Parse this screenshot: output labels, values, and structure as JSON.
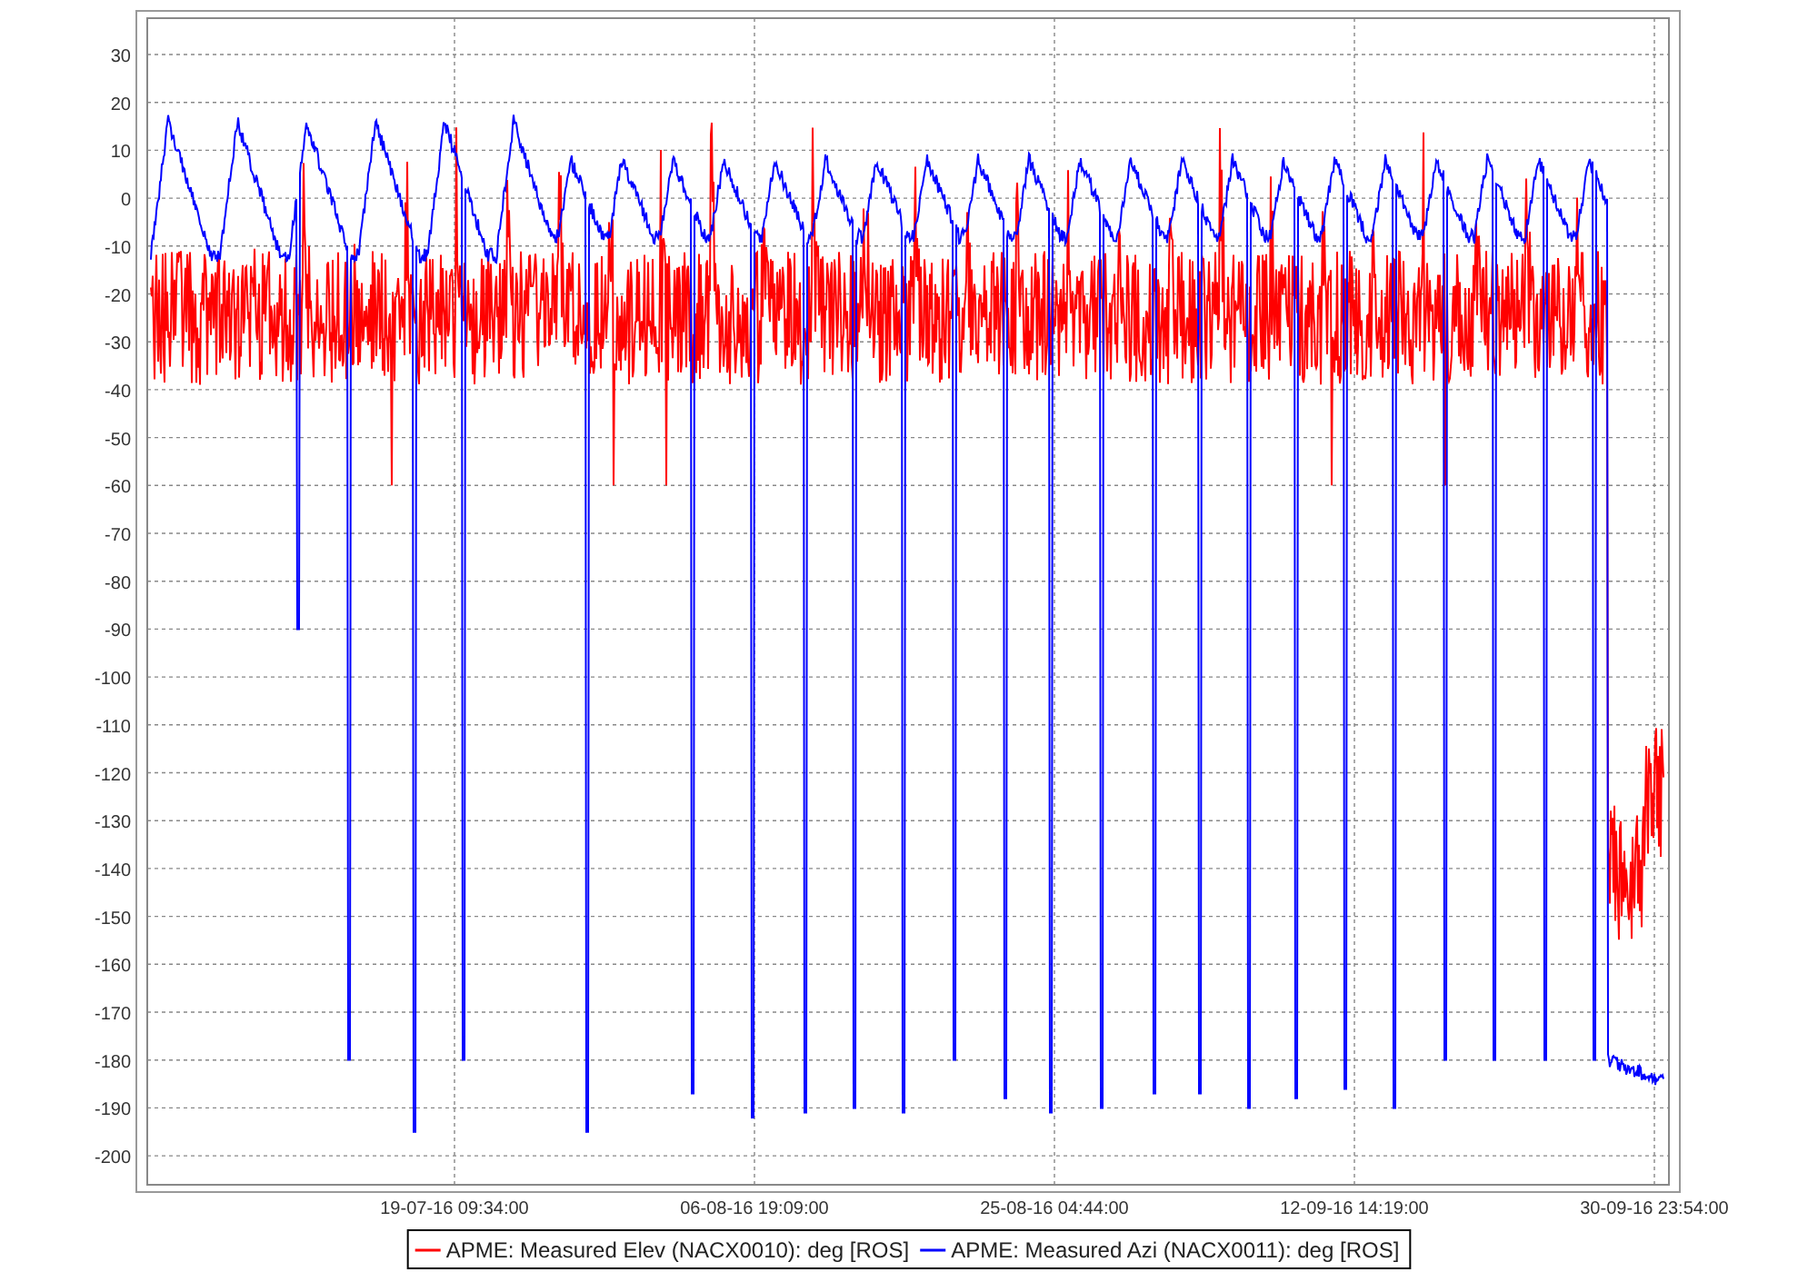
{
  "chart": {
    "y_ticks": [
      "30",
      "20",
      "10",
      "0",
      "-10",
      "-20",
      "-30",
      "-40",
      "-50",
      "-60",
      "-70",
      "-80",
      "-90",
      "-100",
      "-110",
      "-120",
      "-130",
      "-140",
      "-150",
      "-160",
      "-170",
      "-180",
      "-190",
      "-200"
    ],
    "x_ticks": [
      "19-07-16 09:34:00",
      "06-08-16 19:09:00",
      "25-08-16 04:44:00",
      "12-09-16 14:19:00",
      "30-09-16 23:54:00"
    ],
    "legend": [
      {
        "label": "APME: Measured Elev (NACX0010): deg [ROS]",
        "color": "#ff0000"
      },
      {
        "label": "APME: Measured Azi (NACX0011): deg [ROS]",
        "color": "#0000ff"
      }
    ]
  }
}
